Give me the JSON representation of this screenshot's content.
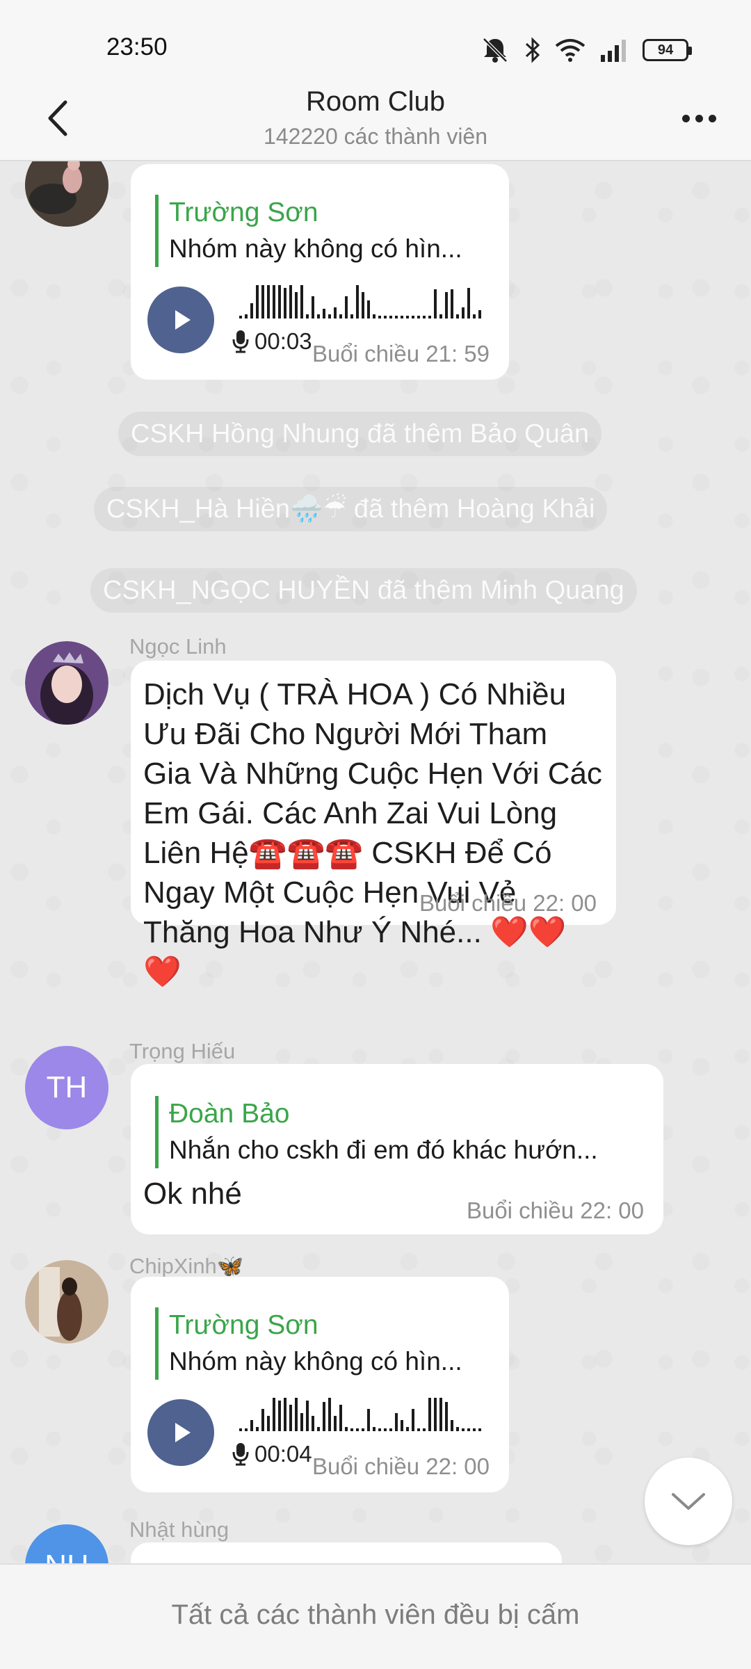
{
  "status_bar": {
    "time": "23:50",
    "battery": "94"
  },
  "header": {
    "title": "Room Club",
    "subtitle": "142220 các thành viên"
  },
  "messages": {
    "m1": {
      "reply_name": "Trường Sơn",
      "reply_text": "Nhóm này không có hìn...",
      "duration": "00:03",
      "time": "Buổi chiều  21: 59"
    },
    "sys1": "CSKH Hồng Nhung đã thêm Bảo Quân",
    "sys2": "CSKH_Hà Hiền🌧️☔ đã thêm Hoàng Khải",
    "sys3": "CSKH_NGỌC HUYỀN đã thêm Minh Quang",
    "m2": {
      "sender": "Ngọc Linh",
      "text": "Dịch Vụ ( TRÀ HOA ) Có Nhiều Ưu Đãi Cho Người Mới Tham Gia Và Những Cuộc Hẹn Với Các Em Gái. Các Anh Zai Vui Lòng Liên Hệ☎️☎️☎️ CSKH Để Có Ngay Một Cuộc Hẹn Vui Vẻ Thăng Hoa Như Ý Nhé... ❤️❤️❤️",
      "time": "Buổi chiều  22: 00"
    },
    "m3": {
      "sender": "Trọng Hiếu",
      "initials": "TH",
      "reply_name": "Đoàn Bảo",
      "reply_text": "Nhắn cho cskh đi em đó khác hướn...",
      "text": "Ok nhé",
      "time": "Buổi chiều  22: 00"
    },
    "m4": {
      "sender": "ChipXinh🦋",
      "reply_name": "Trường Sơn",
      "reply_text": "Nhóm này không có hìn...",
      "duration": "00:04",
      "time": "Buổi chiều  22: 00"
    },
    "m5": {
      "sender": "Nhật  hùng",
      "initials": "NH"
    }
  },
  "bottom_bar": {
    "text": "Tất cả các thành viên đều bị cấm"
  },
  "colors": {
    "accent_green": "#3aa54a",
    "play_button": "#50628f",
    "avatar_purple": "#9b88e8"
  }
}
